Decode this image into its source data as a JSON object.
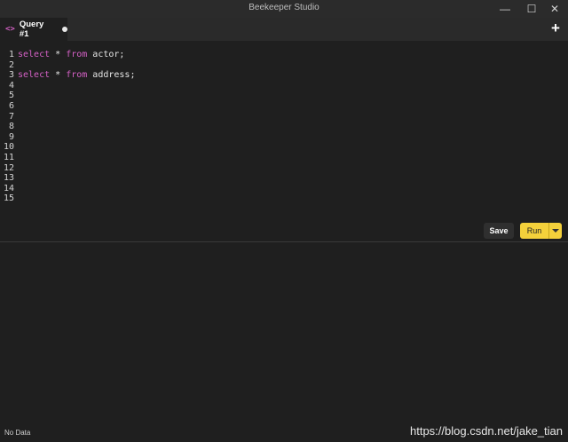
{
  "window": {
    "title": "Beekeeper Studio",
    "minimize": "—",
    "maximize": "☐",
    "close": "✕"
  },
  "tabs": [
    {
      "icon": "<>",
      "label": "Query #1",
      "unsaved": true
    }
  ],
  "add_tab": "+",
  "editor": {
    "line_numbers": [
      "1",
      "2",
      "3",
      "4",
      "5",
      "6",
      "7",
      "8",
      "9",
      "10",
      "11",
      "12",
      "13",
      "14",
      "15"
    ],
    "lines": [
      {
        "kw1": "select",
        "mid": " * ",
        "kw2": "from",
        "rest": " actor;"
      },
      {
        "kw1": "",
        "mid": "",
        "kw2": "",
        "rest": ""
      },
      {
        "kw1": "select",
        "mid": " * ",
        "kw2": "from",
        "rest": " address;"
      }
    ]
  },
  "toolbar": {
    "save_label": "Save",
    "run_label": "Run"
  },
  "status": {
    "text": "No Data",
    "watermark": "https://blog.csdn.net/jake_tian"
  },
  "colors": {
    "accent": "#f4d13b",
    "keyword": "#d561c6",
    "background": "#1f1f1f"
  }
}
